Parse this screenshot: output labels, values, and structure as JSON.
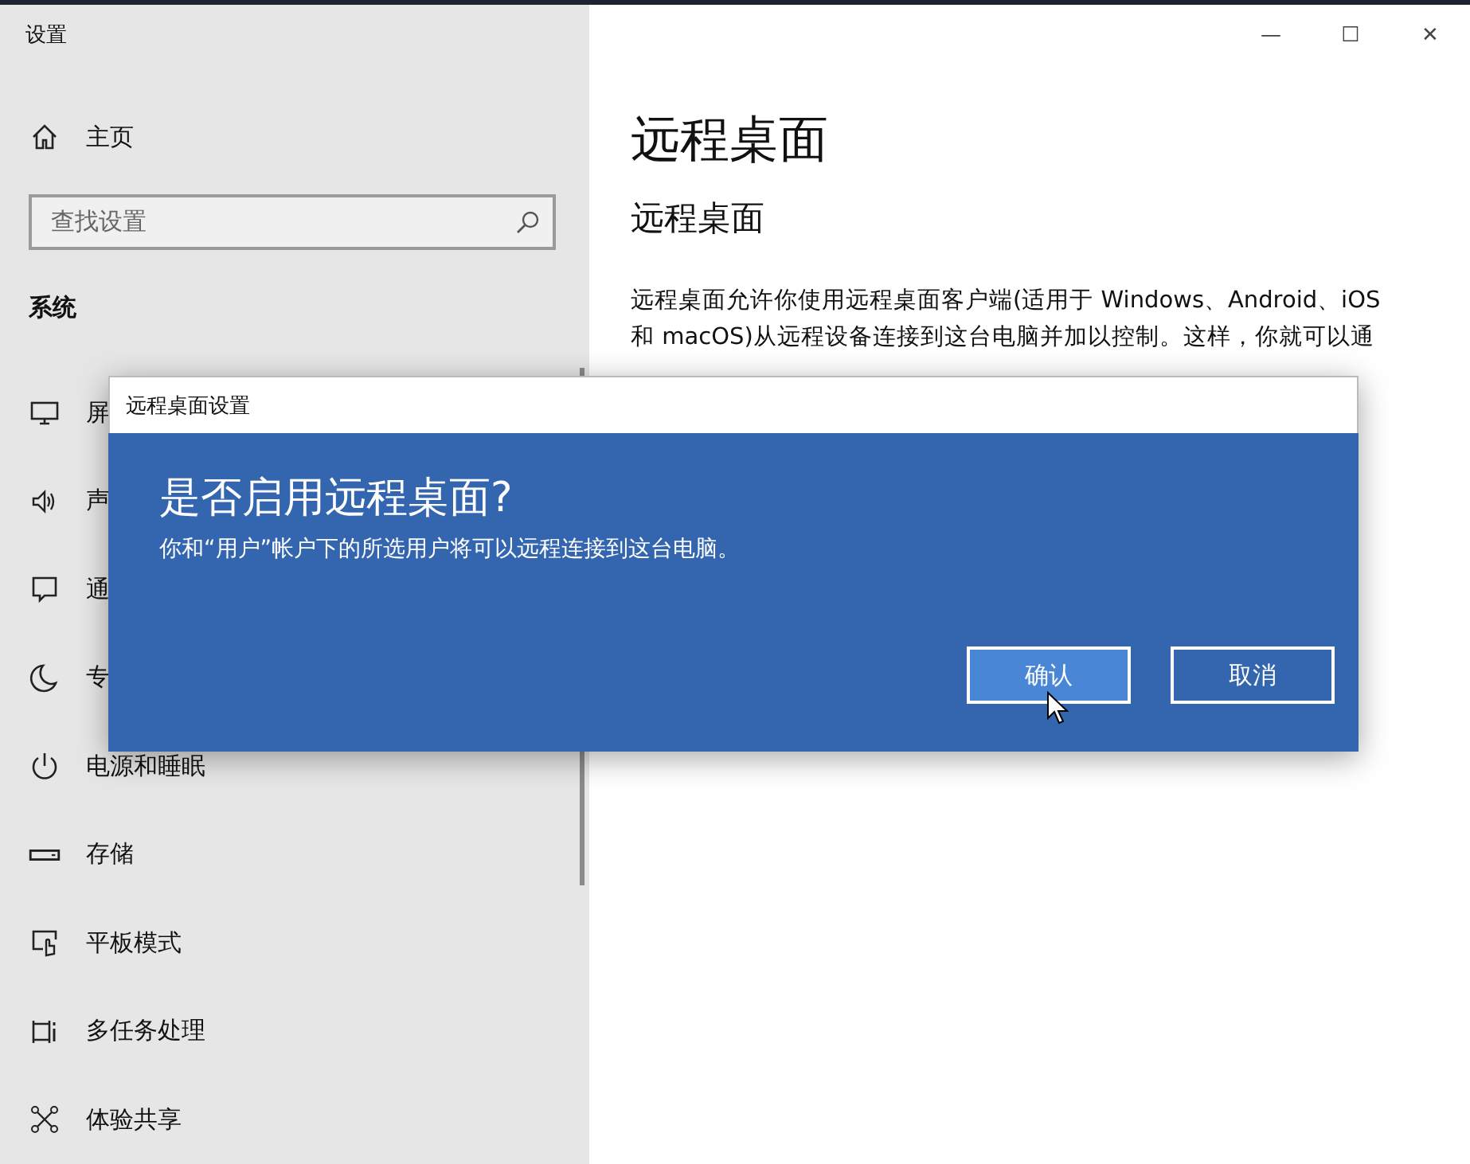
{
  "window": {
    "title": "设置",
    "controls": [
      "—",
      "☐",
      "✕"
    ]
  },
  "sidebar": {
    "home": {
      "label": "主页",
      "kind": "home"
    },
    "search": {
      "placeholder": "查找设置"
    },
    "section": "系统",
    "items": [
      {
        "label": "屏",
        "kind": "display"
      },
      {
        "label": "声",
        "kind": "sound"
      },
      {
        "label": "通",
        "kind": "notifications"
      },
      {
        "label": "专",
        "kind": "focus"
      },
      {
        "label": "电源和睡眠",
        "kind": "power"
      },
      {
        "label": "存储",
        "kind": "storage"
      },
      {
        "label": "平板模式",
        "kind": "tablet"
      },
      {
        "label": "多任务处理",
        "kind": "multitasking"
      },
      {
        "label": "体验共享",
        "kind": "sharing"
      }
    ]
  },
  "content": {
    "title": "远程桌面",
    "subtitle": "远程桌面",
    "description": [
      "远程桌面允许你使用远程桌面客户端(适用于 Windows、Android、iOS",
      "和 macOS)从远程设备连接到这台电脑并加以控制。这样，你就可以通"
    ]
  },
  "dialog": {
    "title": "远程桌面设置",
    "heading": "是否启用远程桌面?",
    "message": "你和“用户”帐户下的所选用户将可以远程连接到这台电脑。",
    "buttons": [
      {
        "label": "确认",
        "hovered": true
      },
      {
        "label": "取消",
        "hovered": false
      }
    ]
  }
}
